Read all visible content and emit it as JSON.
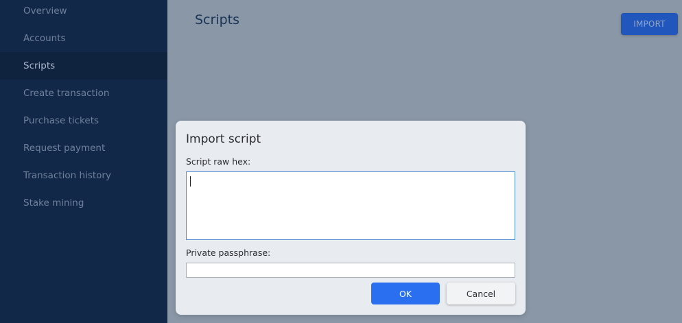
{
  "sidebar": {
    "items": [
      {
        "label": "Overview",
        "active": false
      },
      {
        "label": "Accounts",
        "active": false
      },
      {
        "label": "Scripts",
        "active": true
      },
      {
        "label": "Create transaction",
        "active": false
      },
      {
        "label": "Purchase tickets",
        "active": false
      },
      {
        "label": "Request payment",
        "active": false
      },
      {
        "label": "Transaction history",
        "active": false
      },
      {
        "label": "Stake mining",
        "active": false
      }
    ]
  },
  "main": {
    "title": "Scripts",
    "import_label": "IMPORT"
  },
  "modal": {
    "title": "Import script",
    "hex_label": "Script raw hex:",
    "hex_value": "",
    "pass_label": "Private passphrase:",
    "pass_value": "",
    "ok_label": "OK",
    "cancel_label": "Cancel"
  },
  "colors": {
    "sidebar_bg": "#122848",
    "sidebar_active_bg": "#0f223e",
    "overlay_bg": "#8a97a6",
    "primary_button": "#2a6ff0",
    "import_button": "#2156bd"
  }
}
